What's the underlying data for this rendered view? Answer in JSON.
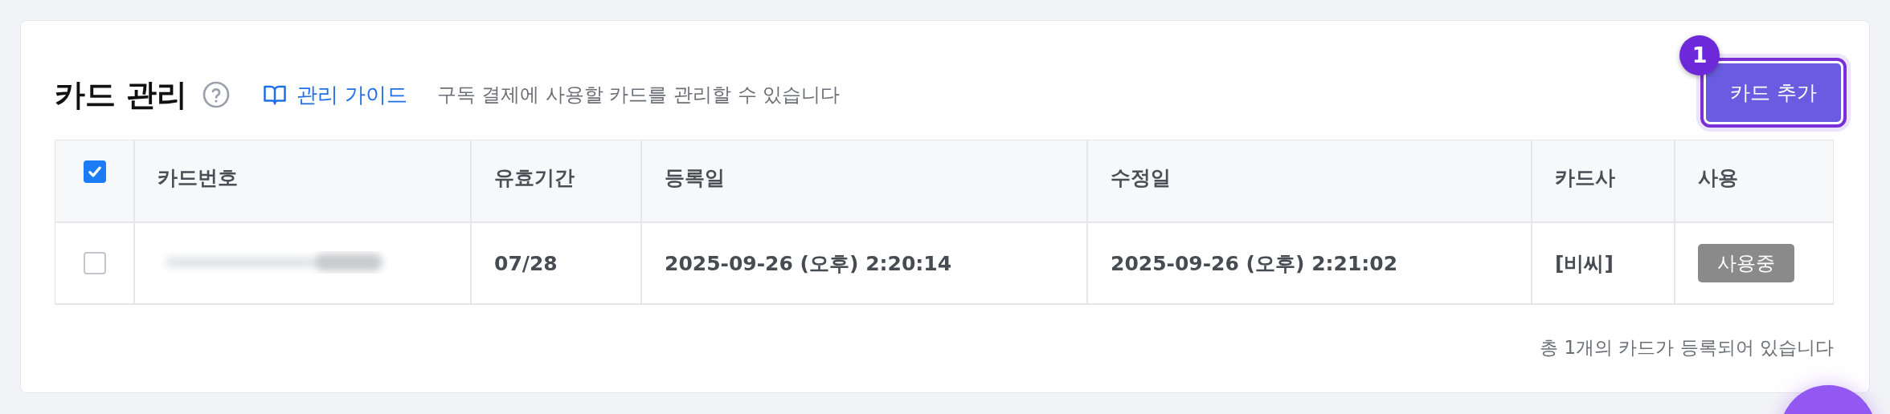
{
  "header": {
    "title": "카드 관리",
    "guide_link": "관리 가이드",
    "description": "구독 결제에 사용할 카드를 관리할 수 있습니다",
    "add_button": "카드 추가",
    "step_badge": "1"
  },
  "table": {
    "select_all": {
      "checked": true
    },
    "columns": [
      "카드번호",
      "유효기간",
      "등록일",
      "수정일",
      "카드사",
      "사용"
    ],
    "rows": [
      {
        "checked": false,
        "card_number_hidden": true,
        "expiry": "07/28",
        "registered": "2025-09-26 (오후) 2:20:14",
        "modified": "2025-09-26 (오후) 2:21:02",
        "issuer": "[비씨]",
        "status": "사용중",
        "in_use": true
      }
    ]
  },
  "footer": "총 1개의 카드가 등록되어 있습니다"
}
